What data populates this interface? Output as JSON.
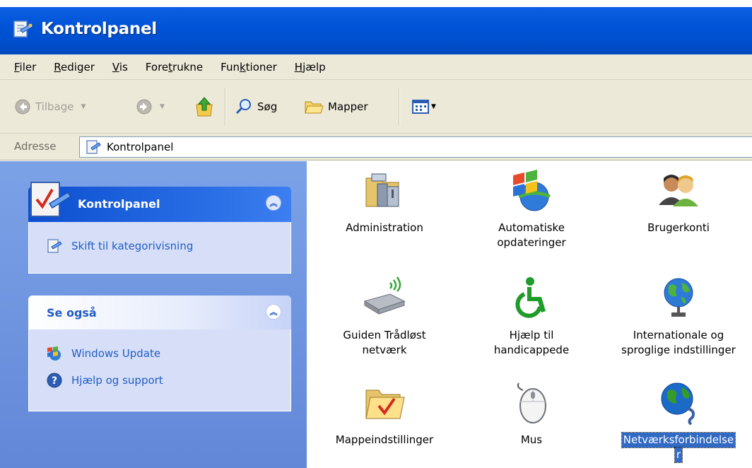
{
  "window": {
    "title": "Kontrolpanel"
  },
  "menubar": {
    "items": [
      {
        "pre": "",
        "u": "F",
        "post": "iler"
      },
      {
        "pre": "",
        "u": "R",
        "post": "ediger"
      },
      {
        "pre": "",
        "u": "V",
        "post": "is"
      },
      {
        "pre": "Fore",
        "u": "t",
        "post": "rukne"
      },
      {
        "pre": "Fun",
        "u": "k",
        "post": "tioner"
      },
      {
        "pre": "",
        "u": "H",
        "post": "jælp"
      }
    ]
  },
  "toolbar": {
    "back_label": "Tilbage",
    "search_label": "Søg",
    "folders_label": "Mapper"
  },
  "address": {
    "label": "Adresse",
    "value": "Kontrolpanel"
  },
  "leftpane": {
    "panel1": {
      "title": "Kontrolpanel",
      "link": "Skift til kategorivisning"
    },
    "panel2": {
      "title": "Se også",
      "links": [
        "Windows Update",
        "Hjælp og support"
      ]
    }
  },
  "items": [
    {
      "label1": "Administration",
      "label2": "",
      "icon": "admin-tools-icon"
    },
    {
      "label1": "Automatiske",
      "label2": "opdateringer",
      "icon": "windows-flag-icon"
    },
    {
      "label1": "Brugerkonti",
      "label2": "",
      "icon": "user-accounts-icon"
    },
    {
      "label1": "Guiden Trådløst",
      "label2": "netværk",
      "icon": "wireless-wizard-icon"
    },
    {
      "label1": "Hjælp til",
      "label2": "handicappede",
      "icon": "accessibility-icon"
    },
    {
      "label1": "Internationale og",
      "label2": "sproglige indstillinger",
      "icon": "globe-icon"
    },
    {
      "label1": "Mappeindstillinger",
      "label2": "",
      "icon": "folder-options-icon"
    },
    {
      "label1": "Mus",
      "label2": "",
      "icon": "mouse-icon"
    },
    {
      "label1": "Netværksforbindelse",
      "label2": "r",
      "icon": "network-connections-icon"
    }
  ],
  "colors": {
    "titlebar": "#0053d6",
    "leftpane": "#6f95e0",
    "link": "#215dc6",
    "selection": "#316ac5"
  }
}
